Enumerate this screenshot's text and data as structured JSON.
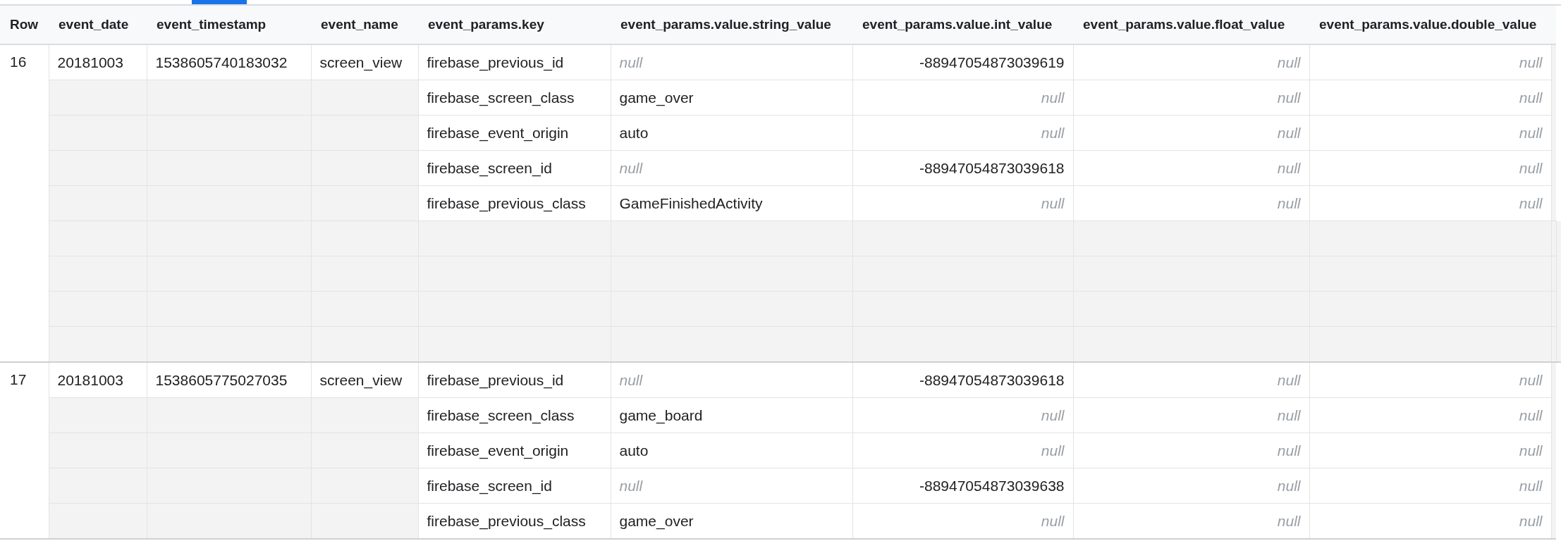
{
  "columns": [
    "Row",
    "event_date",
    "event_timestamp",
    "event_name",
    "event_params.key",
    "event_params.value.string_value",
    "event_params.value.int_value",
    "event_params.value.float_value",
    "event_params.value.double_value"
  ],
  "records": [
    {
      "row": "16",
      "event_date": "20181003",
      "event_timestamp": "1538605740183032",
      "event_name": "screen_view",
      "params": [
        {
          "key": "firebase_previous_id",
          "string_value": {
            "text": "null",
            "is_null": true
          },
          "int_value": {
            "text": "-88947054873039619",
            "is_null": false
          },
          "float_value": {
            "text": "null",
            "is_null": true
          },
          "double_value": {
            "text": "null",
            "is_null": true
          }
        },
        {
          "key": "firebase_screen_class",
          "string_value": {
            "text": "game_over",
            "is_null": false
          },
          "int_value": {
            "text": "null",
            "is_null": true
          },
          "float_value": {
            "text": "null",
            "is_null": true
          },
          "double_value": {
            "text": "null",
            "is_null": true
          }
        },
        {
          "key": "firebase_event_origin",
          "string_value": {
            "text": "auto",
            "is_null": false
          },
          "int_value": {
            "text": "null",
            "is_null": true
          },
          "float_value": {
            "text": "null",
            "is_null": true
          },
          "double_value": {
            "text": "null",
            "is_null": true
          }
        },
        {
          "key": "firebase_screen_id",
          "string_value": {
            "text": "null",
            "is_null": true
          },
          "int_value": {
            "text": "-88947054873039618",
            "is_null": false
          },
          "float_value": {
            "text": "null",
            "is_null": true
          },
          "double_value": {
            "text": "null",
            "is_null": true
          }
        },
        {
          "key": "firebase_previous_class",
          "string_value": {
            "text": "GameFinishedActivity",
            "is_null": false
          },
          "int_value": {
            "text": "null",
            "is_null": true
          },
          "float_value": {
            "text": "null",
            "is_null": true
          },
          "double_value": {
            "text": "null",
            "is_null": true
          }
        }
      ],
      "blank_rows": [
        {},
        {},
        {},
        {}
      ]
    },
    {
      "row": "17",
      "event_date": "20181003",
      "event_timestamp": "1538605775027035",
      "event_name": "screen_view",
      "params": [
        {
          "key": "firebase_previous_id",
          "string_value": {
            "text": "null",
            "is_null": true
          },
          "int_value": {
            "text": "-88947054873039618",
            "is_null": false
          },
          "float_value": {
            "text": "null",
            "is_null": true
          },
          "double_value": {
            "text": "null",
            "is_null": true
          }
        },
        {
          "key": "firebase_screen_class",
          "string_value": {
            "text": "game_board",
            "is_null": false
          },
          "int_value": {
            "text": "null",
            "is_null": true
          },
          "float_value": {
            "text": "null",
            "is_null": true
          },
          "double_value": {
            "text": "null",
            "is_null": true
          }
        },
        {
          "key": "firebase_event_origin",
          "string_value": {
            "text": "auto",
            "is_null": false
          },
          "int_value": {
            "text": "null",
            "is_null": true
          },
          "float_value": {
            "text": "null",
            "is_null": true
          },
          "double_value": {
            "text": "null",
            "is_null": true
          }
        },
        {
          "key": "firebase_screen_id",
          "string_value": {
            "text": "null",
            "is_null": true
          },
          "int_value": {
            "text": "-88947054873039638",
            "is_null": false
          },
          "float_value": {
            "text": "null",
            "is_null": true
          },
          "double_value": {
            "text": "null",
            "is_null": true
          }
        },
        {
          "key": "firebase_previous_class",
          "string_value": {
            "text": "game_over",
            "is_null": false
          },
          "int_value": {
            "text": "null",
            "is_null": true
          },
          "float_value": {
            "text": "null",
            "is_null": true
          },
          "double_value": {
            "text": "null",
            "is_null": true
          }
        }
      ]
    }
  ]
}
